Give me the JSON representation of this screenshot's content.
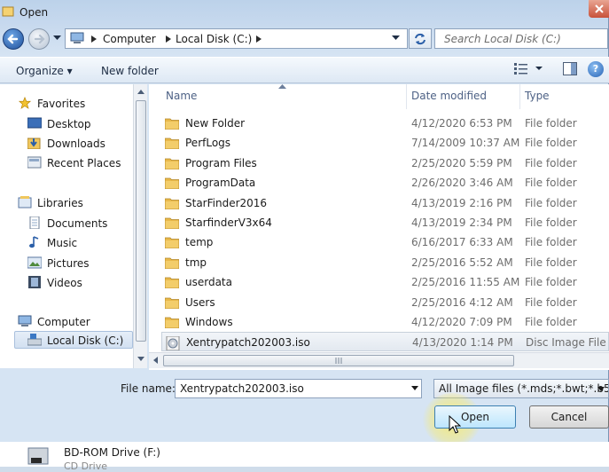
{
  "window": {
    "title": "Open"
  },
  "address": {
    "crumbs": [
      "Computer",
      "Local Disk (C:)"
    ],
    "search_placeholder": "Search Local Disk (C:)"
  },
  "toolbar": {
    "organize": "Organize ▾",
    "new_folder": "New folder"
  },
  "nav": {
    "favorites": "Favorites",
    "desktop": "Desktop",
    "downloads": "Downloads",
    "recent": "Recent Places",
    "libraries": "Libraries",
    "documents": "Documents",
    "music": "Music",
    "pictures": "Pictures",
    "videos": "Videos",
    "computer": "Computer",
    "local_disk": "Local Disk (C:)"
  },
  "columns": {
    "name": "Name",
    "date": "Date modified",
    "type": "Type"
  },
  "files": [
    {
      "name": "New Folder",
      "date": "4/12/2020 6:53 PM",
      "type": "File folder"
    },
    {
      "name": "PerfLogs",
      "date": "7/14/2009 10:37 AM",
      "type": "File folder"
    },
    {
      "name": "Program Files",
      "date": "2/25/2020 5:59 PM",
      "type": "File folder"
    },
    {
      "name": "ProgramData",
      "date": "2/26/2020 3:46 AM",
      "type": "File folder"
    },
    {
      "name": "StarFinder2016",
      "date": "4/13/2019 2:16 PM",
      "type": "File folder"
    },
    {
      "name": "StarfinderV3x64",
      "date": "4/13/2019 2:34 PM",
      "type": "File folder"
    },
    {
      "name": "temp",
      "date": "6/16/2017 6:33 AM",
      "type": "File folder"
    },
    {
      "name": "tmp",
      "date": "2/25/2016 5:52 AM",
      "type": "File folder"
    },
    {
      "name": "userdata",
      "date": "2/25/2016 11:55 AM",
      "type": "File folder"
    },
    {
      "name": "Users",
      "date": "2/25/2016 4:12 AM",
      "type": "File folder"
    },
    {
      "name": "Windows",
      "date": "4/12/2020 7:09 PM",
      "type": "File folder"
    },
    {
      "name": "Xentrypatch202003.iso",
      "date": "4/13/2020 1:14 PM",
      "type": "Disc Image File"
    }
  ],
  "bottom": {
    "file_name_label": "File name:",
    "file_name_value": "Xentrypatch202003.iso",
    "file_type": "All Image files (*.mds;*.bwt;*.b5",
    "open_label": "Open",
    "cancel_label": "Cancel"
  },
  "background": {
    "drive_label": "BD-ROM Drive (F:)",
    "drive_sub": "CD Drive"
  },
  "colors": {
    "folder": "#e8b84a",
    "selection": "#d2e0f1",
    "accent": "#3c7fb1"
  }
}
